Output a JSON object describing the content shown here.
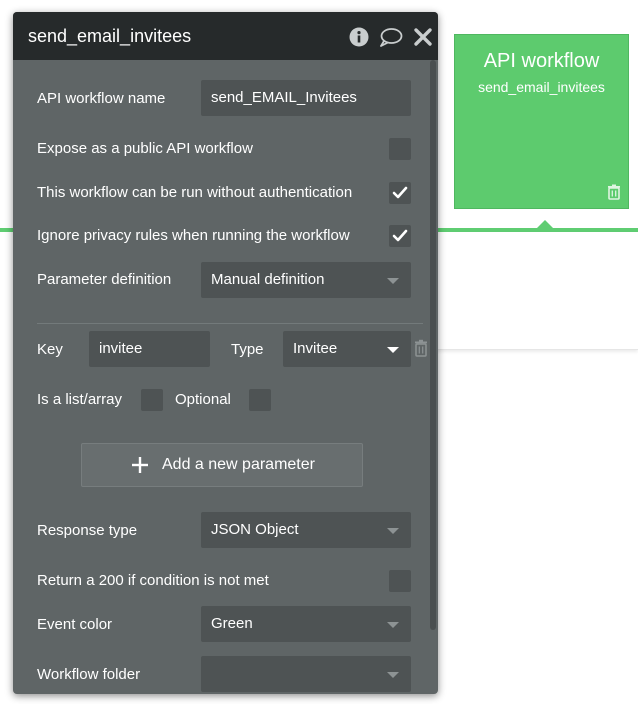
{
  "workflow_card": {
    "title": "API workflow",
    "subtitle": "send_email_invitees",
    "color": "#5dcb6e",
    "icon": "trash-icon"
  },
  "panel": {
    "title": "send_email_invitees",
    "header_icons": [
      "info-icon",
      "comment-icon",
      "close-icon"
    ]
  },
  "form": {
    "workflow_name_label": "API workflow name",
    "workflow_name_value": "send_EMAIL_Invitees",
    "expose_public_label": "Expose as a public API workflow",
    "expose_public_checked": false,
    "no_auth_label": "This workflow can be run without authentication",
    "no_auth_checked": true,
    "ignore_privacy_label": "Ignore privacy rules when running the workflow",
    "ignore_privacy_checked": true,
    "param_def_label": "Parameter definition",
    "param_def_value": "Manual definition",
    "param": {
      "key_label": "Key",
      "key_value": "invitee",
      "type_label": "Type",
      "type_value": "Invitee",
      "list_label": "Is a list/array",
      "list_checked": false,
      "optional_label": "Optional",
      "optional_checked": false
    },
    "add_param_label": "Add a new parameter",
    "response_type_label": "Response type",
    "response_type_value": "JSON Object",
    "return200_label": "Return a 200 if condition is not met",
    "return200_checked": false,
    "event_color_label": "Event color",
    "event_color_value": "Green",
    "folder_label": "Workflow folder",
    "folder_value": ""
  }
}
